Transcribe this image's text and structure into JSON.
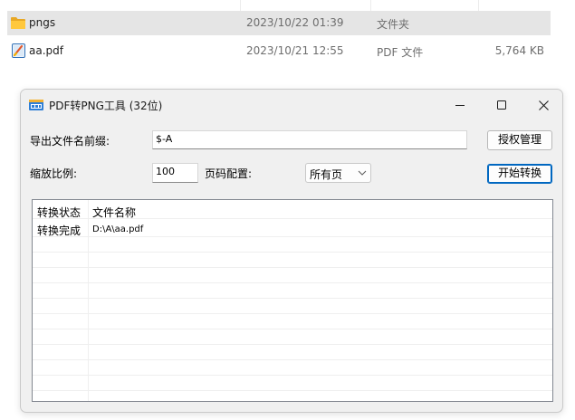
{
  "explorer": {
    "rows": [
      {
        "name": "pngs",
        "date": "2023/10/22 01:39",
        "type": "文件夹",
        "size": "",
        "icon": "folder-icon",
        "selected": true
      },
      {
        "name": "aa.pdf",
        "date": "2023/10/21 12:55",
        "type": "PDF 文件",
        "size": "5,764 KB",
        "icon": "pdf-file-icon",
        "selected": false
      }
    ]
  },
  "window": {
    "title": "PDF转PNG工具 (32位)",
    "icon": "app-icon",
    "controls": {
      "minimize": "minimize-icon",
      "maximize": "maximize-icon",
      "close": "close-icon"
    }
  },
  "form": {
    "prefix_label": "导出文件名前缀:",
    "prefix_value": "$-A",
    "license_button": "授权管理",
    "scale_label": "缩放比例:",
    "scale_value": "100",
    "page_label": "页码配置:",
    "page_selected": "所有页",
    "start_button": "开始转换"
  },
  "list": {
    "columns": [
      "转换状态",
      "文件名称"
    ],
    "rows": [
      {
        "status": "转换完成",
        "file": "D:\\A\\aa.pdf"
      }
    ]
  },
  "colors": {
    "accent": "#0067c0",
    "selection": "#e5e5e5",
    "window_bg": "#f0f0f0"
  }
}
